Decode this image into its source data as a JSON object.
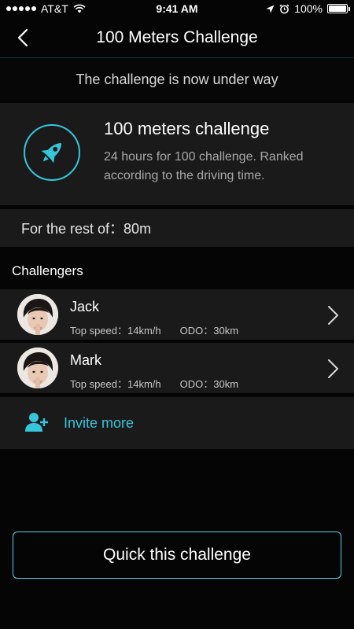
{
  "status_bar": {
    "carrier": "AT&T",
    "time": "9:41 AM",
    "battery": "100%",
    "battery_level": 1.0
  },
  "nav": {
    "title": "100 Meters Challenge",
    "back_icon": "chevron-left-icon"
  },
  "banner": "The challenge is now under way",
  "challenge": {
    "icon": "rocket-icon",
    "title": "100 meters challenge",
    "description": "24 hours for 100 challenge. Ranked according to the driving time."
  },
  "rest": "For the rest of：80m",
  "section_label": "Challengers",
  "challengers": [
    {
      "name": "Jack",
      "top_speed": "Top speed：14km/h",
      "odo": "ODO：30km"
    },
    {
      "name": "Mark",
      "top_speed": "Top speed：14km/h",
      "odo": "ODO：30km"
    }
  ],
  "invite": {
    "label": "Invite more",
    "icon": "add-user-icon"
  },
  "quit_button": "Quick this challenge",
  "colors": {
    "accent": "#35c6dc",
    "background": "#050505",
    "card": "#1a1a1a"
  }
}
